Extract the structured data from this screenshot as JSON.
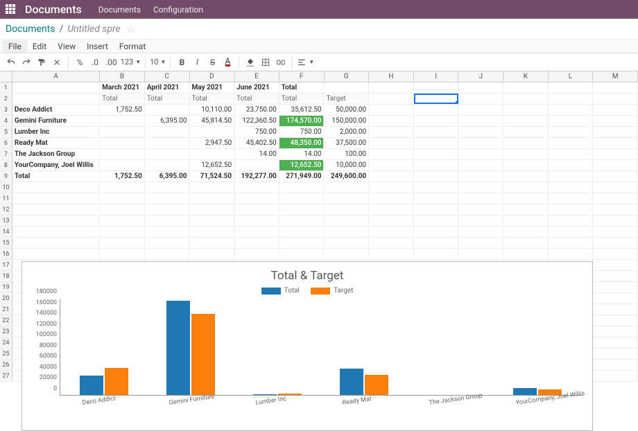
{
  "topbar": {
    "brand": "Documents",
    "nav": [
      "Documents",
      "Configuration"
    ]
  },
  "breadcrumb": {
    "root": "Documents",
    "current": "Untitled spre"
  },
  "menus": [
    "File",
    "Edit",
    "View",
    "Insert",
    "Format"
  ],
  "toolbar": {
    "num_format": "123",
    "font_size": "10"
  },
  "columns": [
    "A",
    "B",
    "C",
    "D",
    "E",
    "F",
    "G",
    "H",
    "I",
    "J",
    "K",
    "L",
    "M"
  ],
  "sheet": {
    "header_row": [
      "",
      "March 2021",
      "April 2021",
      "May 2021",
      "June 2021",
      "Total",
      ""
    ],
    "sub_row": [
      "",
      "Total",
      "Total",
      "Total",
      "Total",
      "Total",
      "Target"
    ],
    "data_rows": [
      {
        "name": "Deco Addict",
        "vals": [
          "1,752.50",
          "",
          "10,110.00",
          "23,750.00",
          "35,612.50",
          "50,000.00"
        ],
        "green": []
      },
      {
        "name": "Gemini Furniture",
        "vals": [
          "",
          "6,395.00",
          "45,814.50",
          "122,360.50",
          "174,570.00",
          "150,000.00"
        ],
        "green": [
          4
        ]
      },
      {
        "name": "Lumber Inc",
        "vals": [
          "",
          "",
          "",
          "750.00",
          "750.00",
          "2,000.00"
        ],
        "green": []
      },
      {
        "name": "Ready Mat",
        "vals": [
          "",
          "",
          "2,947.50",
          "45,402.50",
          "48,350.00",
          "37,500.00"
        ],
        "green": [
          4
        ]
      },
      {
        "name": "The Jackson Group",
        "vals": [
          "",
          "",
          "",
          "14.00",
          "14.00",
          "100.00"
        ],
        "green": []
      },
      {
        "name": "YourCompany, Joel Willis",
        "vals": [
          "",
          "",
          "12,652.50",
          "",
          "12,652.50",
          "10,000.00"
        ],
        "green": [
          4
        ]
      }
    ],
    "total_row": {
      "name": "Total",
      "vals": [
        "1,752.50",
        "6,395.00",
        "71,524.50",
        "192,277.00",
        "271,949.00",
        "249,600.00"
      ]
    }
  },
  "chart_data": {
    "type": "bar",
    "title": "Total & Target",
    "categories": [
      "Deco Addict",
      "Gemini Furniture",
      "Lumber Inc",
      "Ready Mat",
      "The Jackson Group",
      "YourCompany, Joel Willis"
    ],
    "series": [
      {
        "name": "Total",
        "values": [
          35612.5,
          174570.0,
          750.0,
          48350.0,
          14.0,
          12652.5
        ]
      },
      {
        "name": "Target",
        "values": [
          50000.0,
          150000.0,
          2000.0,
          37500.0,
          100.0,
          10000.0
        ]
      }
    ],
    "ylim": [
      0,
      180000
    ],
    "yticks": [
      0,
      20000,
      40000,
      60000,
      80000,
      100000,
      120000,
      140000,
      160000,
      180000
    ],
    "colors": {
      "Total": "#1f77b4",
      "Target": "#ff7f0e"
    }
  },
  "active_cell": "I2"
}
